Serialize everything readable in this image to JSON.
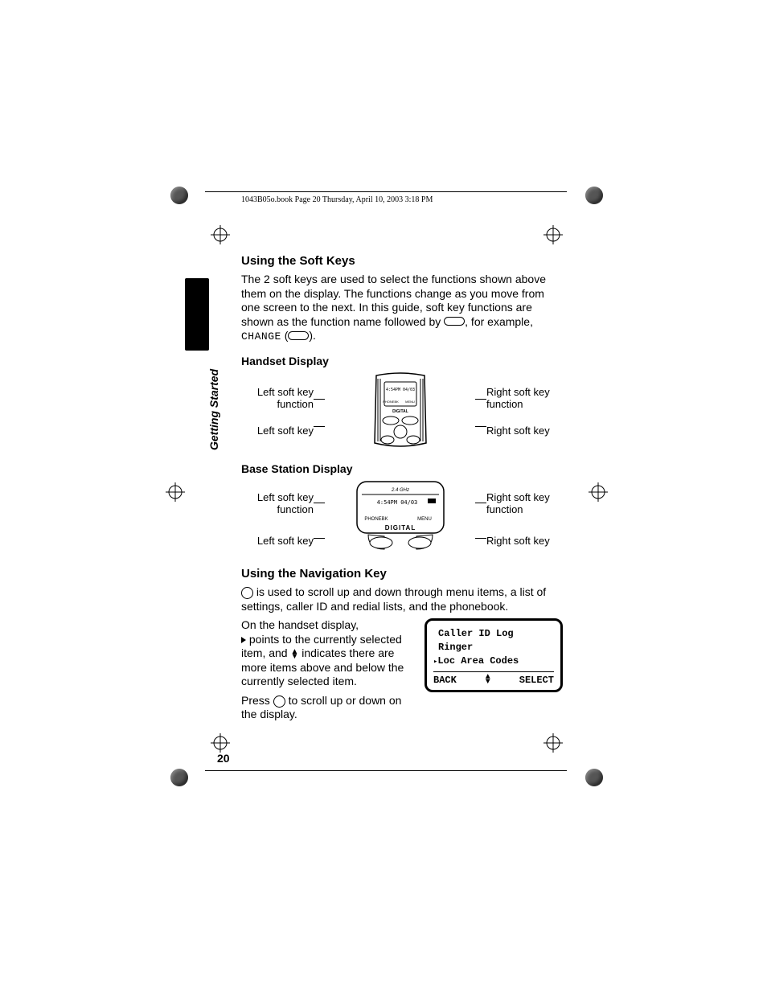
{
  "header": "1043B05o.book  Page 20  Thursday, April 10, 2003  3:18 PM",
  "side_label": "Getting Started",
  "page_number": "20",
  "s1": {
    "title": "Using the Soft Keys",
    "para1a": "The 2 soft keys are used to select the functions shown above them on the display. The functions change as you move from one screen to the next. In this guide, soft key functions are shown as the function name followed by ",
    "para1b": ", for example, ",
    "change_label": "CHANGE",
    "para1c": " (",
    "para1d": ")."
  },
  "handset": {
    "title": "Handset Display",
    "left_fn": "Left soft key function",
    "right_fn": "Right soft key function",
    "left_key": "Left soft key",
    "right_key": "Right soft key",
    "screen_time": "4:54PM 04/03",
    "screen_left": "PHONEBK",
    "screen_right": "MENU",
    "screen_brand": "DIGITAL"
  },
  "base": {
    "title": "Base Station Display",
    "left_fn": "Left soft key function",
    "right_fn": "Right soft key function",
    "left_key": "Left soft key",
    "right_key": "Right soft key",
    "screen_top": "2.4 GHz",
    "screen_time": "4:54PM 04/03",
    "screen_left": "PHONEBK",
    "screen_right": "MENU",
    "screen_brand": "DIGITAL"
  },
  "s2": {
    "title": "Using the Navigation Key",
    "para1": " is used to scroll up and down through menu items, a list of settings, caller ID and redial lists, and the phonebook.",
    "para2a": "On the handset display, ",
    "para2b": " points to the currently selected item, and ",
    "para2c": " indicates there are more items above and below the currently selected item.",
    "para3a": "Press ",
    "para3b": " to scroll up or down on the display."
  },
  "menu_screen": {
    "item1": "Caller ID Log",
    "item2": "Ringer",
    "item3": "Loc Area Codes",
    "soft_left": "BACK",
    "soft_right": "SELECT"
  }
}
